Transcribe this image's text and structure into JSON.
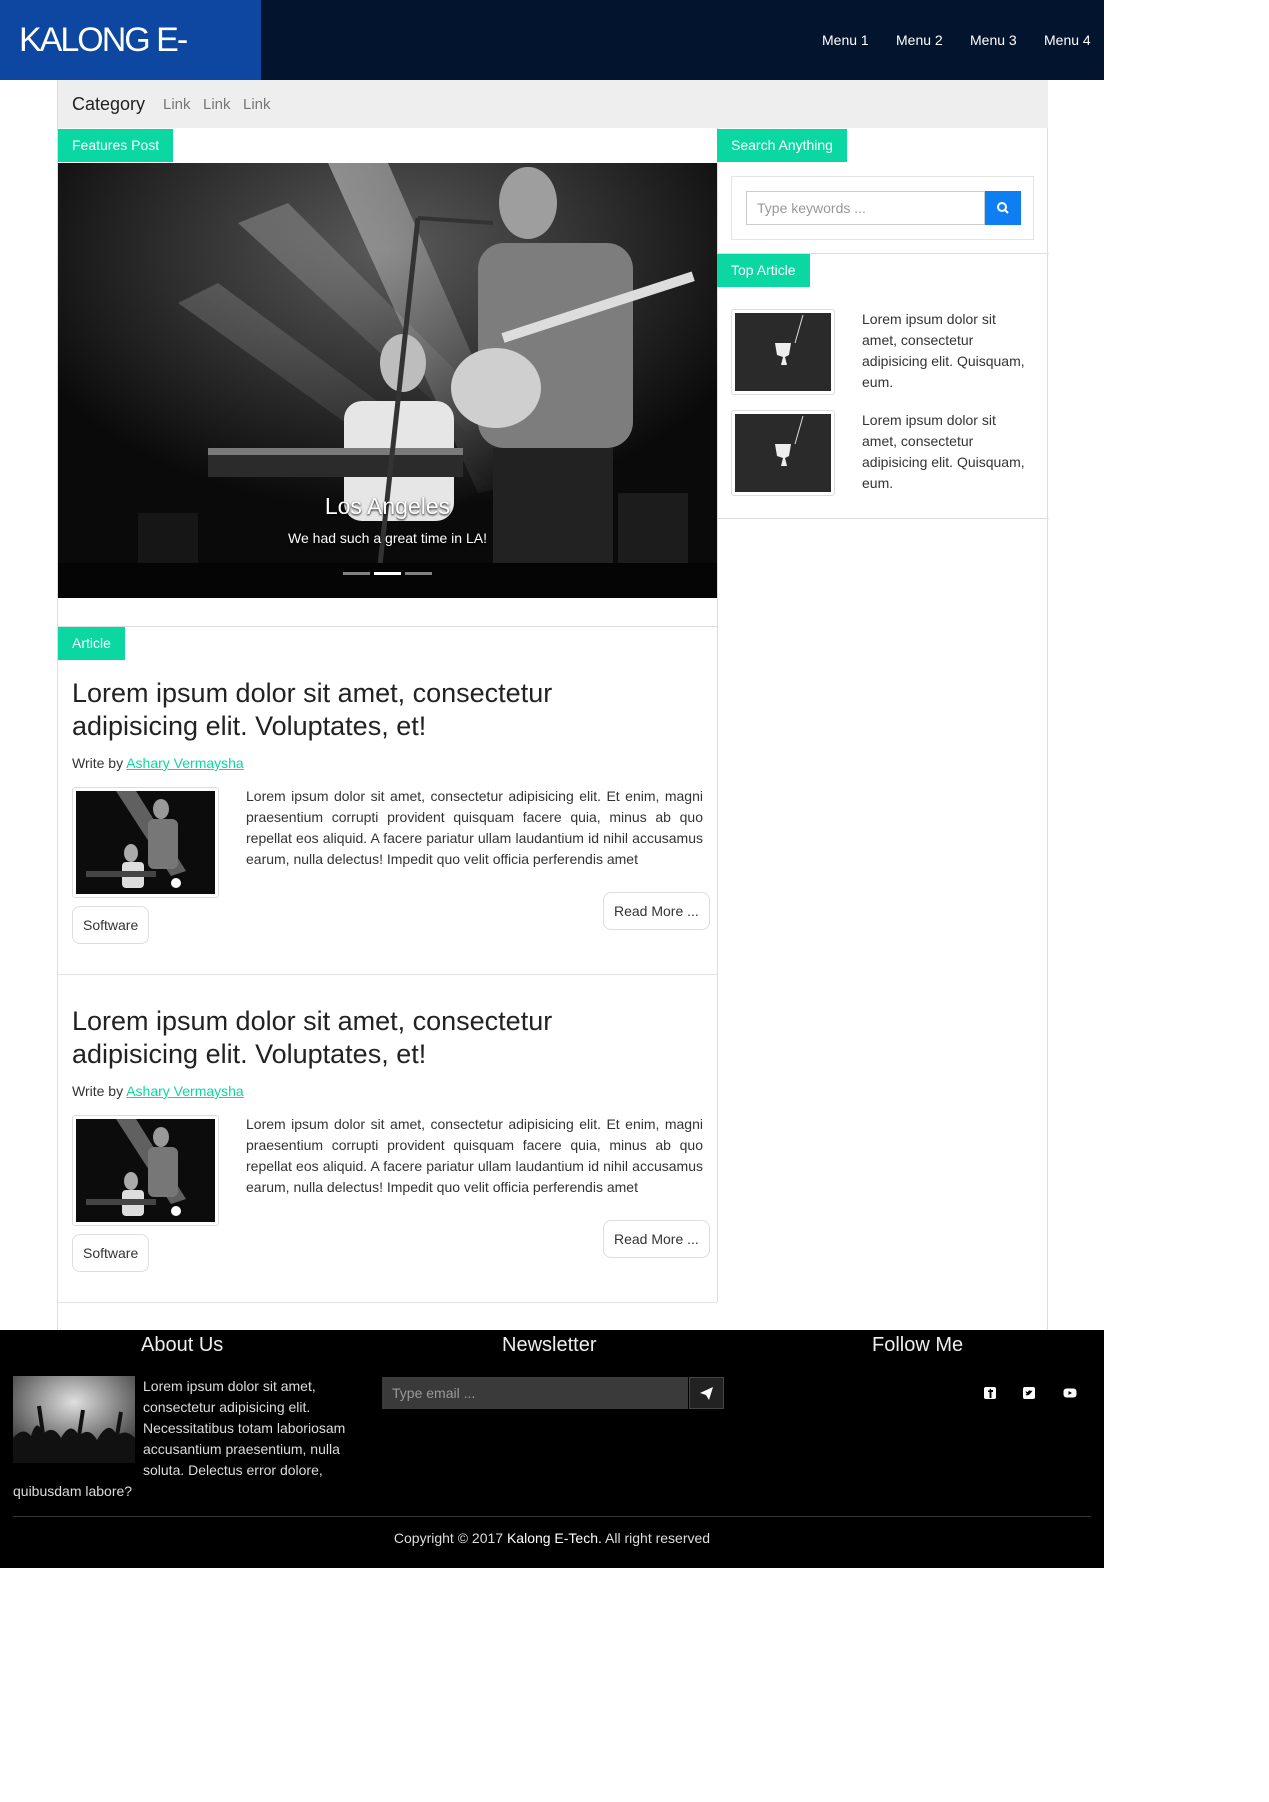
{
  "navbar": {
    "brand": "KALONG E- TECH",
    "menu": [
      "Menu 1",
      "Menu 2",
      "Menu 3",
      "Menu 4"
    ]
  },
  "categories": {
    "title": "Category",
    "links": [
      "Link",
      "Link",
      "Link"
    ]
  },
  "features": {
    "tag": "Features Post",
    "slide_title": "Los Angeles",
    "slide_caption": "We had such a great time in LA!",
    "slide_count": 3,
    "active_slide": 2
  },
  "articles": {
    "tag": "Article",
    "items": [
      {
        "title": "Lorem ipsum dolor sit amet, consectetur adipisicing elit. Voluptates, et!",
        "write_by": "Write by",
        "author": "Ashary Vermaysha",
        "body": "Lorem ipsum dolor sit amet, consectetur adipisicing elit. Et enim, magni praesentium corrupti provident quisquam facere quia, minus ab quo repellat eos aliquid. A facere pariatur ullam laudantium id nihil accusamus earum, nulla delectus! Impedit quo velit officia perferendis amet",
        "read_more": "Read More ...",
        "category": "Software"
      },
      {
        "title": "Lorem ipsum dolor sit amet, consectetur adipisicing elit. Voluptates, et!",
        "write_by": "Write by",
        "author": "Ashary Vermaysha",
        "body": "Lorem ipsum dolor sit amet, consectetur adipisicing elit. Et enim, magni praesentium corrupti provident quisquam facere quia, minus ab quo repellat eos aliquid. A facere pariatur ullam laudantium id nihil accusamus earum, nulla delectus! Impedit quo velit officia perferendis amet",
        "read_more": "Read More ...",
        "category": "Software"
      }
    ]
  },
  "sidebar": {
    "search_tag": "Search Anything",
    "search_placeholder": "Type keywords ...",
    "top_tag": "Top Article",
    "top_articles": [
      {
        "text": "Lorem ipsum dolor sit amet, consectetur adipisicing elit. Quisquam, eum."
      },
      {
        "text": "Lorem ipsum dolor sit amet, consectetur adipisicing elit. Quisquam, eum."
      }
    ]
  },
  "footer": {
    "about_title": "About Us",
    "about_text": "Lorem ipsum dolor sit amet, consectetur adipisicing elit. Necessitatibus totam laboriosam accusantium praesentium, nulla soluta. Delectus error dolore, quibusdam labore?",
    "newsletter_title": "Newsletter",
    "newsletter_placeholder": "Type email ...",
    "follow_title": "Follow Me",
    "social_icons": [
      "facebook-icon",
      "twitter-icon",
      "youtube-icon"
    ],
    "copyright_prefix": "Copyright © 2017",
    "copyright_brand": "Kalong E-Tech.",
    "copyright_suffix": "All right reserved"
  },
  "colors": {
    "navbar": "#03142e",
    "brand": "#0d47a1",
    "accent": "#0bd7a3",
    "search_button": "#0d7ff2",
    "footer": "#000000"
  }
}
